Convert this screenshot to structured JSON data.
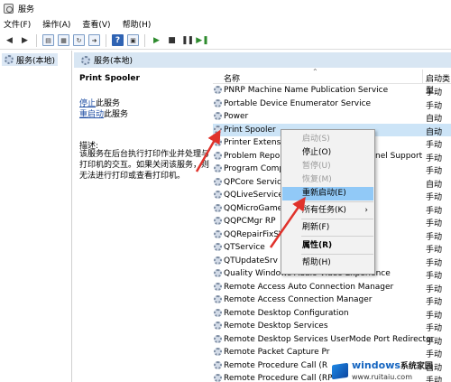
{
  "window": {
    "title": "服务"
  },
  "menu": [
    "文件(F)",
    "操作(A)",
    "查看(V)",
    "帮助(H)"
  ],
  "toolbar": {
    "back_icon": "arrow-left-icon",
    "forward_icon": "arrow-right-icon",
    "help_glyph": "?"
  },
  "tree": {
    "root_label": "服务(本地)"
  },
  "pane_header": {
    "title": "服务(本地)"
  },
  "details": {
    "service_name": "Print Spooler",
    "stop_link": "停止",
    "stop_suffix": "此服务",
    "restart_link": "重启动",
    "restart_suffix": "此服务",
    "description_label": "描述:",
    "description": "该服务在后台执行打印作业并处理与打印机的交互。如果关闭该服务，则无法进行打印或查看打印机。"
  },
  "columns": {
    "name": "名称",
    "startup": "启动类型"
  },
  "services": [
    {
      "name": "PNRP Machine Name Publication Service",
      "startup": "手动"
    },
    {
      "name": "Portable Device Enumerator Service",
      "startup": "手动"
    },
    {
      "name": "Power",
      "startup": "自动"
    },
    {
      "name": "Print Spooler",
      "startup": "自动",
      "selected": true
    },
    {
      "name": "Printer Extensio",
      "startup": "手动"
    },
    {
      "name": "Problem Repor",
      "name_tail": "nel Support",
      "startup": "手动"
    },
    {
      "name": "Program Comp",
      "startup": "手动"
    },
    {
      "name": "QPCore Service",
      "startup": "自动"
    },
    {
      "name": "QQLiveService",
      "startup": "手动"
    },
    {
      "name": "QQMicroGame",
      "startup": "手动"
    },
    {
      "name": "QQPCMgr RP",
      "startup": "手动"
    },
    {
      "name": "QQRepairFixSV",
      "startup": "手动"
    },
    {
      "name": "QTService",
      "startup": "手动"
    },
    {
      "name": "QTUpdateSrv",
      "startup": "手动"
    },
    {
      "name": "Quality Windows Audio Video Experience",
      "startup": "手动"
    },
    {
      "name": "Remote Access Auto Connection Manager",
      "startup": "手动"
    },
    {
      "name": "Remote Access Connection Manager",
      "startup": "手动"
    },
    {
      "name": "Remote Desktop Configuration",
      "startup": "手动"
    },
    {
      "name": "Remote Desktop Services",
      "startup": "手动"
    },
    {
      "name": "Remote Desktop Services UserMode Port Redirector",
      "startup": "手动"
    },
    {
      "name": "Remote Packet Capture Pr",
      "startup": "手动"
    },
    {
      "name": "Remote Procedure Call (R",
      "startup": "自动"
    },
    {
      "name": "Remote Procedure Call (RP",
      "startup": "手动"
    }
  ],
  "context_menu": {
    "items": [
      {
        "label": "启动(S)",
        "state": "disabled"
      },
      {
        "label": "停止(O)",
        "state": "enabled"
      },
      {
        "label": "暂停(U)",
        "state": "disabled"
      },
      {
        "label": "恢复(M)",
        "state": "disabled"
      },
      {
        "label": "重新启动(E)",
        "state": "highlight"
      },
      {
        "label": "所有任务(K)",
        "state": "enabled",
        "submenu_glyph": "›"
      },
      {
        "label": "刷新(F)",
        "state": "enabled"
      },
      {
        "label": "属性(R)",
        "state": "bold"
      },
      {
        "label": "帮助(H)",
        "state": "enabled"
      }
    ]
  },
  "annotation": {
    "arrow_color": "#e0322b"
  },
  "watermark": {
    "brand": "windows",
    "brand_cn": "系统家园",
    "url": "www.ruitaiu.com"
  }
}
